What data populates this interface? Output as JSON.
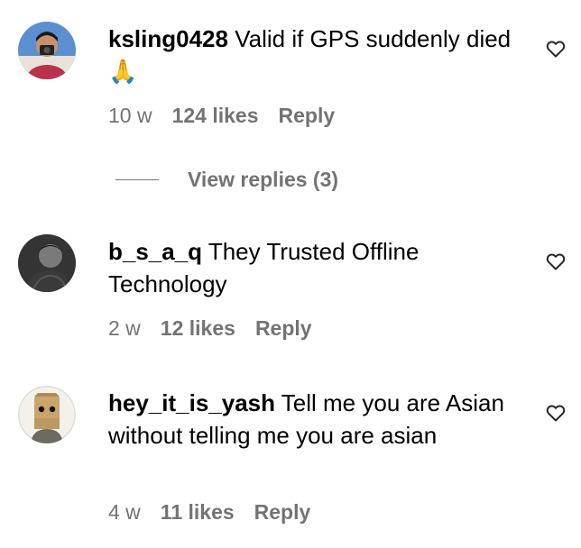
{
  "comments": [
    {
      "username": "ksling0428",
      "text": "Valid if GPS suddenly died🙏",
      "time": "10 w",
      "likes": "124 likes",
      "reply": "Reply",
      "avatar_icon": "person-with-camera-avatar",
      "heart_icon": "heart-outline-icon"
    },
    {
      "username": "b_s_a_q",
      "text": "They Trusted Offline Technology",
      "time": "2 w",
      "likes": "12 likes",
      "reply": "Reply",
      "avatar_icon": "dark-portrait-avatar",
      "heart_icon": "heart-outline-icon"
    },
    {
      "username": "hey_it_is_yash",
      "text": "Tell me you are Asian without telling me you are asian",
      "time": "4 w",
      "likes": "11 likes",
      "reply": "Reply",
      "avatar_icon": "paper-bag-head-avatar",
      "heart_icon": "heart-outline-icon"
    }
  ],
  "view_replies": {
    "label": "View replies (3)"
  },
  "colors": {
    "secondary_text": "#737373",
    "primary_text": "#000000",
    "background": "#ffffff"
  }
}
